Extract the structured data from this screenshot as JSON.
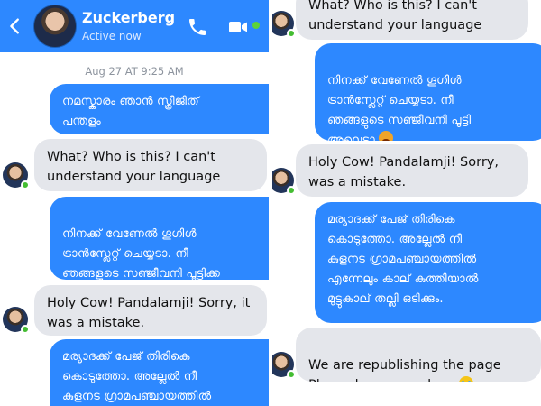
{
  "header": {
    "name": "Zuckerberg",
    "status": "Active now",
    "icons": [
      "back-arrow-icon",
      "phone-icon",
      "video-camera-icon"
    ],
    "accent_color": "#2d88ff"
  },
  "left": {
    "timestamp": "Aug 27 AT 9:25 AM",
    "messages": [
      {
        "from": "me",
        "text": "നമസ്കാരം ഞാൻ സ്ത്രീജിത്\nപന്തളം"
      },
      {
        "from": "them",
        "text": "What? Who is this? I can't\nunderstand your language"
      },
      {
        "from": "me",
        "text": "നിനക്ക് വേണേൽ ഗൂഗിൾ\nട്രാൻസ്ലേറ്റ് ചെയ്യടാ. നീ\nഞങ്ങളുടെ സഞ്ജീവനി പൂട്ടിക്ക\nഅല്ലെടാ",
        "emoji": "angry-face"
      },
      {
        "from": "them",
        "text": "Holy Cow! Pandalamji! Sorry, it\nwas a mistake."
      },
      {
        "from": "me",
        "text": "മര്യാദക്ക് പേജ് തിരികെ\nകൊടുത്തോ. അല്ലേൽ നീ\nകുളനട ഗ്രാമപഞ്ചായത്തിൽ"
      }
    ]
  },
  "right": {
    "messages": [
      {
        "from": "them",
        "text": "What? Who is this? I can't\nunderstand your language"
      },
      {
        "from": "me",
        "text": "നിനക്ക് വേണേൽ ഗൂഗിൾ\nട്രാൻസ്ലേറ്റ് ചെയ്യടാ. നീ\nഞങ്ങളുടെ സഞ്ജീവനി പൂട്ടി\nഅല്ലെടാ",
        "emoji": "angry-face"
      },
      {
        "from": "them",
        "text": "Holy Cow! Pandalamji! Sorry,\nwas a mistake."
      },
      {
        "from": "me",
        "text": "മര്യാദക്ക് പേജ് തിരികെ\nകൊടുത്തോ. അല്ലേൽ നീ\nകുളനട ഗ്രാമപഞ്ചായത്തിൽ\nഎന്നേലും കാല് കുത്തിയാൽ\nമുട്ടുകാല് തല്ലി ഒടിക്കും."
      },
      {
        "from": "them",
        "text": "We are republishing the page\nPlease leave me alone",
        "emoji": "crying-face"
      }
    ]
  }
}
